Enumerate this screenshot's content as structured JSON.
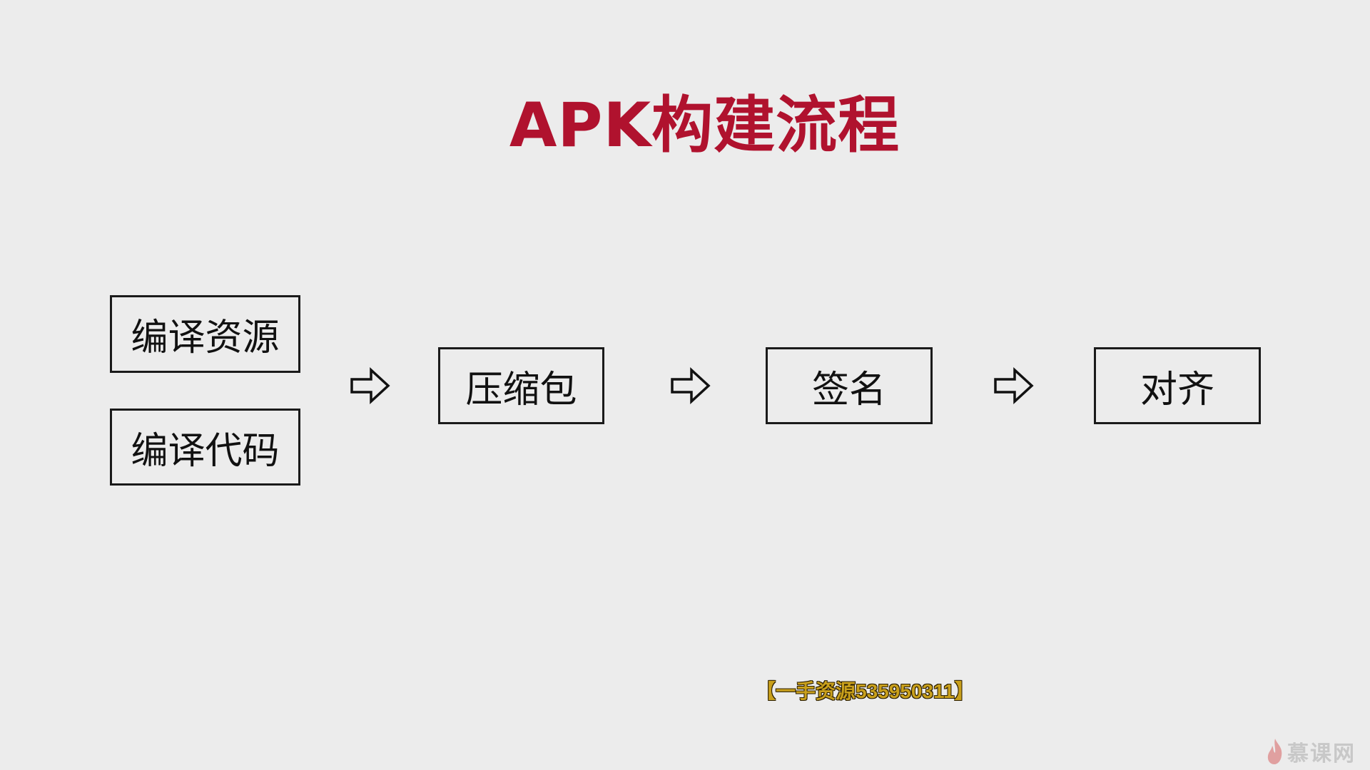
{
  "title": "APK构建流程",
  "steps": {
    "compile_resources": "编译资源",
    "compile_code": "编译代码",
    "compress_package": "压缩包",
    "sign": "签名",
    "align": "对齐"
  },
  "arrows": [
    "arrow-right-icon",
    "arrow-right-icon",
    "arrow-right-icon"
  ],
  "watermark": "【一手资源535950311】",
  "logo": {
    "text": "慕课网",
    "icon": "flame-icon"
  },
  "colors": {
    "title": "#b0122e",
    "background": "#ececec",
    "box_border": "#1a1a1a",
    "watermark": "#c9a01c"
  }
}
